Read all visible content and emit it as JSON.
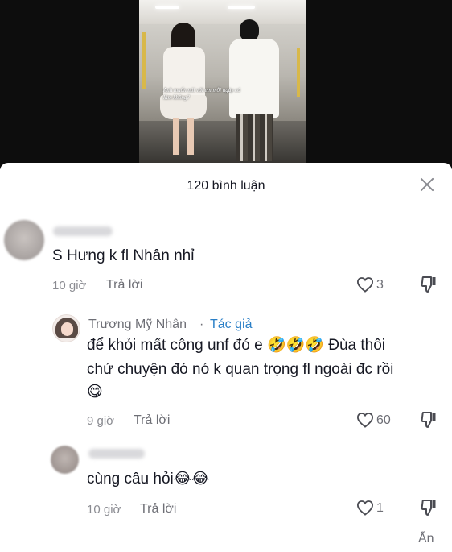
{
  "video": {
    "caption": "Anh muốn nói với em mỗi ngày có làm không?"
  },
  "comments_sheet": {
    "title": "120 bình luận"
  },
  "comments": [
    {
      "text": "S Hưng k fl Nhân nhỉ",
      "time": "10 giờ",
      "reply_label": "Trả lời",
      "likes": "3"
    },
    {
      "username": "Trương Mỹ Nhân",
      "separator": "·",
      "author_tag": "Tác giả",
      "text_line1": "để khỏi mất công unf đó e",
      "text_line1_tail": "Đùa thôi",
      "text_line2": "chứ chuyện đó nó k quan trọng fl ngoài đc rồi",
      "emoji_laugh": "🤣",
      "emoji_smile": "😋",
      "time": "9 giờ",
      "reply_label": "Trả lời",
      "likes": "60"
    },
    {
      "text": "cùng câu hỏi",
      "emoji_joy": "😂",
      "time": "10 giờ",
      "reply_label": "Trả lời",
      "likes": "1"
    }
  ],
  "footer": {
    "hide_label": "Ẩn"
  },
  "icons": [
    "close-icon",
    "heart-icon",
    "dislike-icon",
    "avatar"
  ],
  "colors": {
    "author_tag": "#2a7fc7",
    "text": "#161823",
    "muted": "#8a8b91"
  }
}
